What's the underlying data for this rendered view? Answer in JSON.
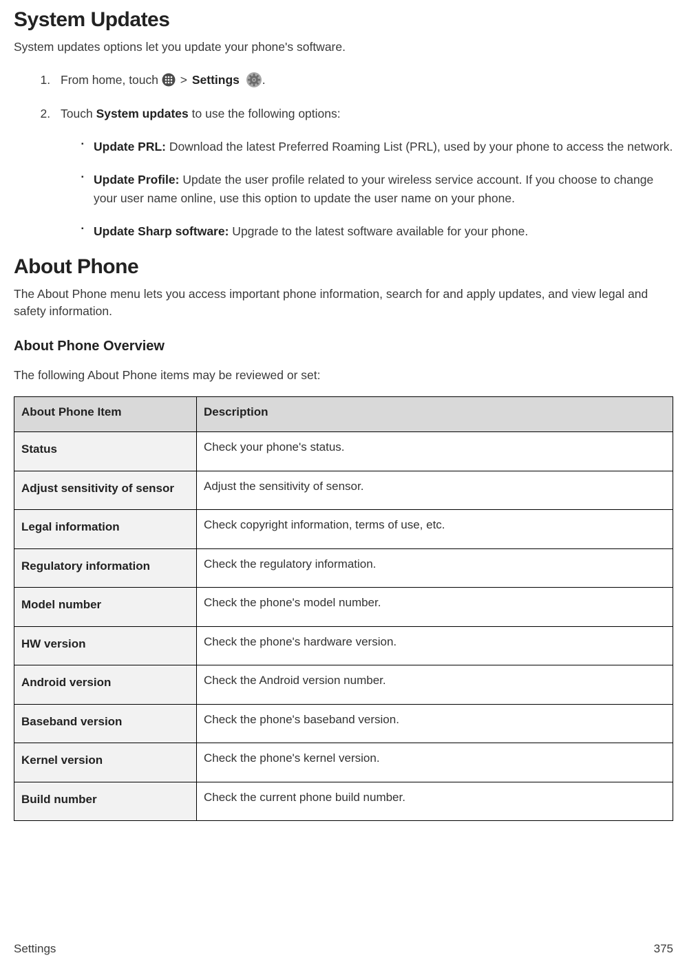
{
  "section1": {
    "heading": "System Updates",
    "intro": "System updates options let you update your phone's software.",
    "step1_pre": "From home, touch ",
    "step1_sep": " > ",
    "step1_settings": "Settings",
    "step1_post": ".",
    "step2_pre": "Touch ",
    "step2_bold": "System updates",
    "step2_post": " to use the following options:",
    "bullets": [
      {
        "bold": "Update PRL:",
        "text": " Download the latest Preferred Roaming List (PRL), used by your phone to access the network."
      },
      {
        "bold": "Update Profile:",
        "text": " Update the user profile related to your wireless service account. If you choose to change your user name online, use this option to update the user name on your phone."
      },
      {
        "bold": "Update Sharp software:",
        "text": " Upgrade to the latest software available for your phone."
      }
    ]
  },
  "section2": {
    "heading": "About Phone",
    "intro": "The About Phone menu lets you access important phone information, search for and apply updates, and view legal and safety information.",
    "sub_heading": "About Phone Overview",
    "sub_intro": "The following About Phone items may be reviewed or set:",
    "table_header_item": "About Phone Item",
    "table_header_desc": "Description",
    "rows": [
      {
        "item": "Status",
        "desc": "Check your phone's status."
      },
      {
        "item": "Adjust sensitivity of sensor",
        "desc": "Adjust the sensitivity of sensor."
      },
      {
        "item": "Legal information",
        "desc": "Check copyright information, terms of use, etc."
      },
      {
        "item": "Regulatory information",
        "desc": "Check the regulatory information."
      },
      {
        "item": "Model number",
        "desc": "Check the phone's model number."
      },
      {
        "item": "HW version",
        "desc": "Check the phone's hardware version."
      },
      {
        "item": "Android version",
        "desc": "Check the Android version number."
      },
      {
        "item": "Baseband version",
        "desc": "Check the phone's baseband version."
      },
      {
        "item": "Kernel version",
        "desc": "Check the phone's kernel version."
      },
      {
        "item": "Build number",
        "desc": "Check the current phone build number."
      }
    ]
  },
  "footer": {
    "section": "Settings",
    "page": "375"
  }
}
